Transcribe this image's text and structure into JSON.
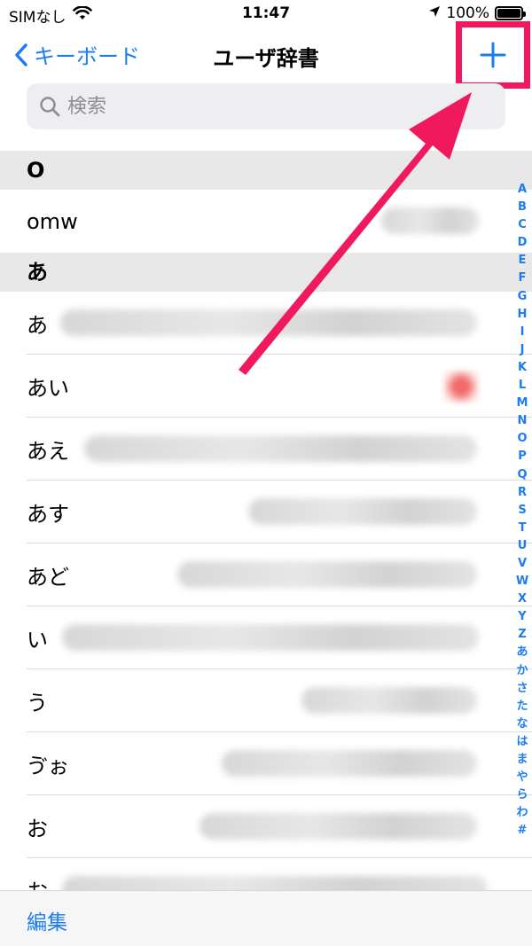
{
  "status_bar": {
    "carrier": "SIMなし",
    "time": "11:47",
    "battery": "100%",
    "battery_level": 1.0
  },
  "nav": {
    "back_label": "キーボード",
    "title": "ユーザ辞書",
    "add_icon": "plus-icon"
  },
  "search": {
    "placeholder": "検索"
  },
  "sections": [
    {
      "header": "O",
      "rows": [
        {
          "reading": "omw"
        }
      ]
    },
    {
      "header": "あ",
      "rows": [
        {
          "reading": "あ"
        },
        {
          "reading": "あい"
        },
        {
          "reading": "あえ"
        },
        {
          "reading": "あす"
        },
        {
          "reading": "あど"
        },
        {
          "reading": "い"
        },
        {
          "reading": "う"
        },
        {
          "reading": "ゔぉ"
        },
        {
          "reading": "お"
        },
        {
          "reading": "お"
        }
      ]
    }
  ],
  "index": [
    "A",
    "B",
    "C",
    "D",
    "E",
    "F",
    "G",
    "H",
    "I",
    "J",
    "K",
    "L",
    "M",
    "N",
    "O",
    "P",
    "Q",
    "R",
    "S",
    "T",
    "U",
    "V",
    "W",
    "X",
    "Y",
    "Z",
    "あ",
    "か",
    "さ",
    "た",
    "な",
    "は",
    "ま",
    "や",
    "ら",
    "わ",
    "#"
  ],
  "toolbar": {
    "edit_label": "編集"
  },
  "colors": {
    "accent": "#1b7cf4",
    "annotation": "#f0195e"
  }
}
